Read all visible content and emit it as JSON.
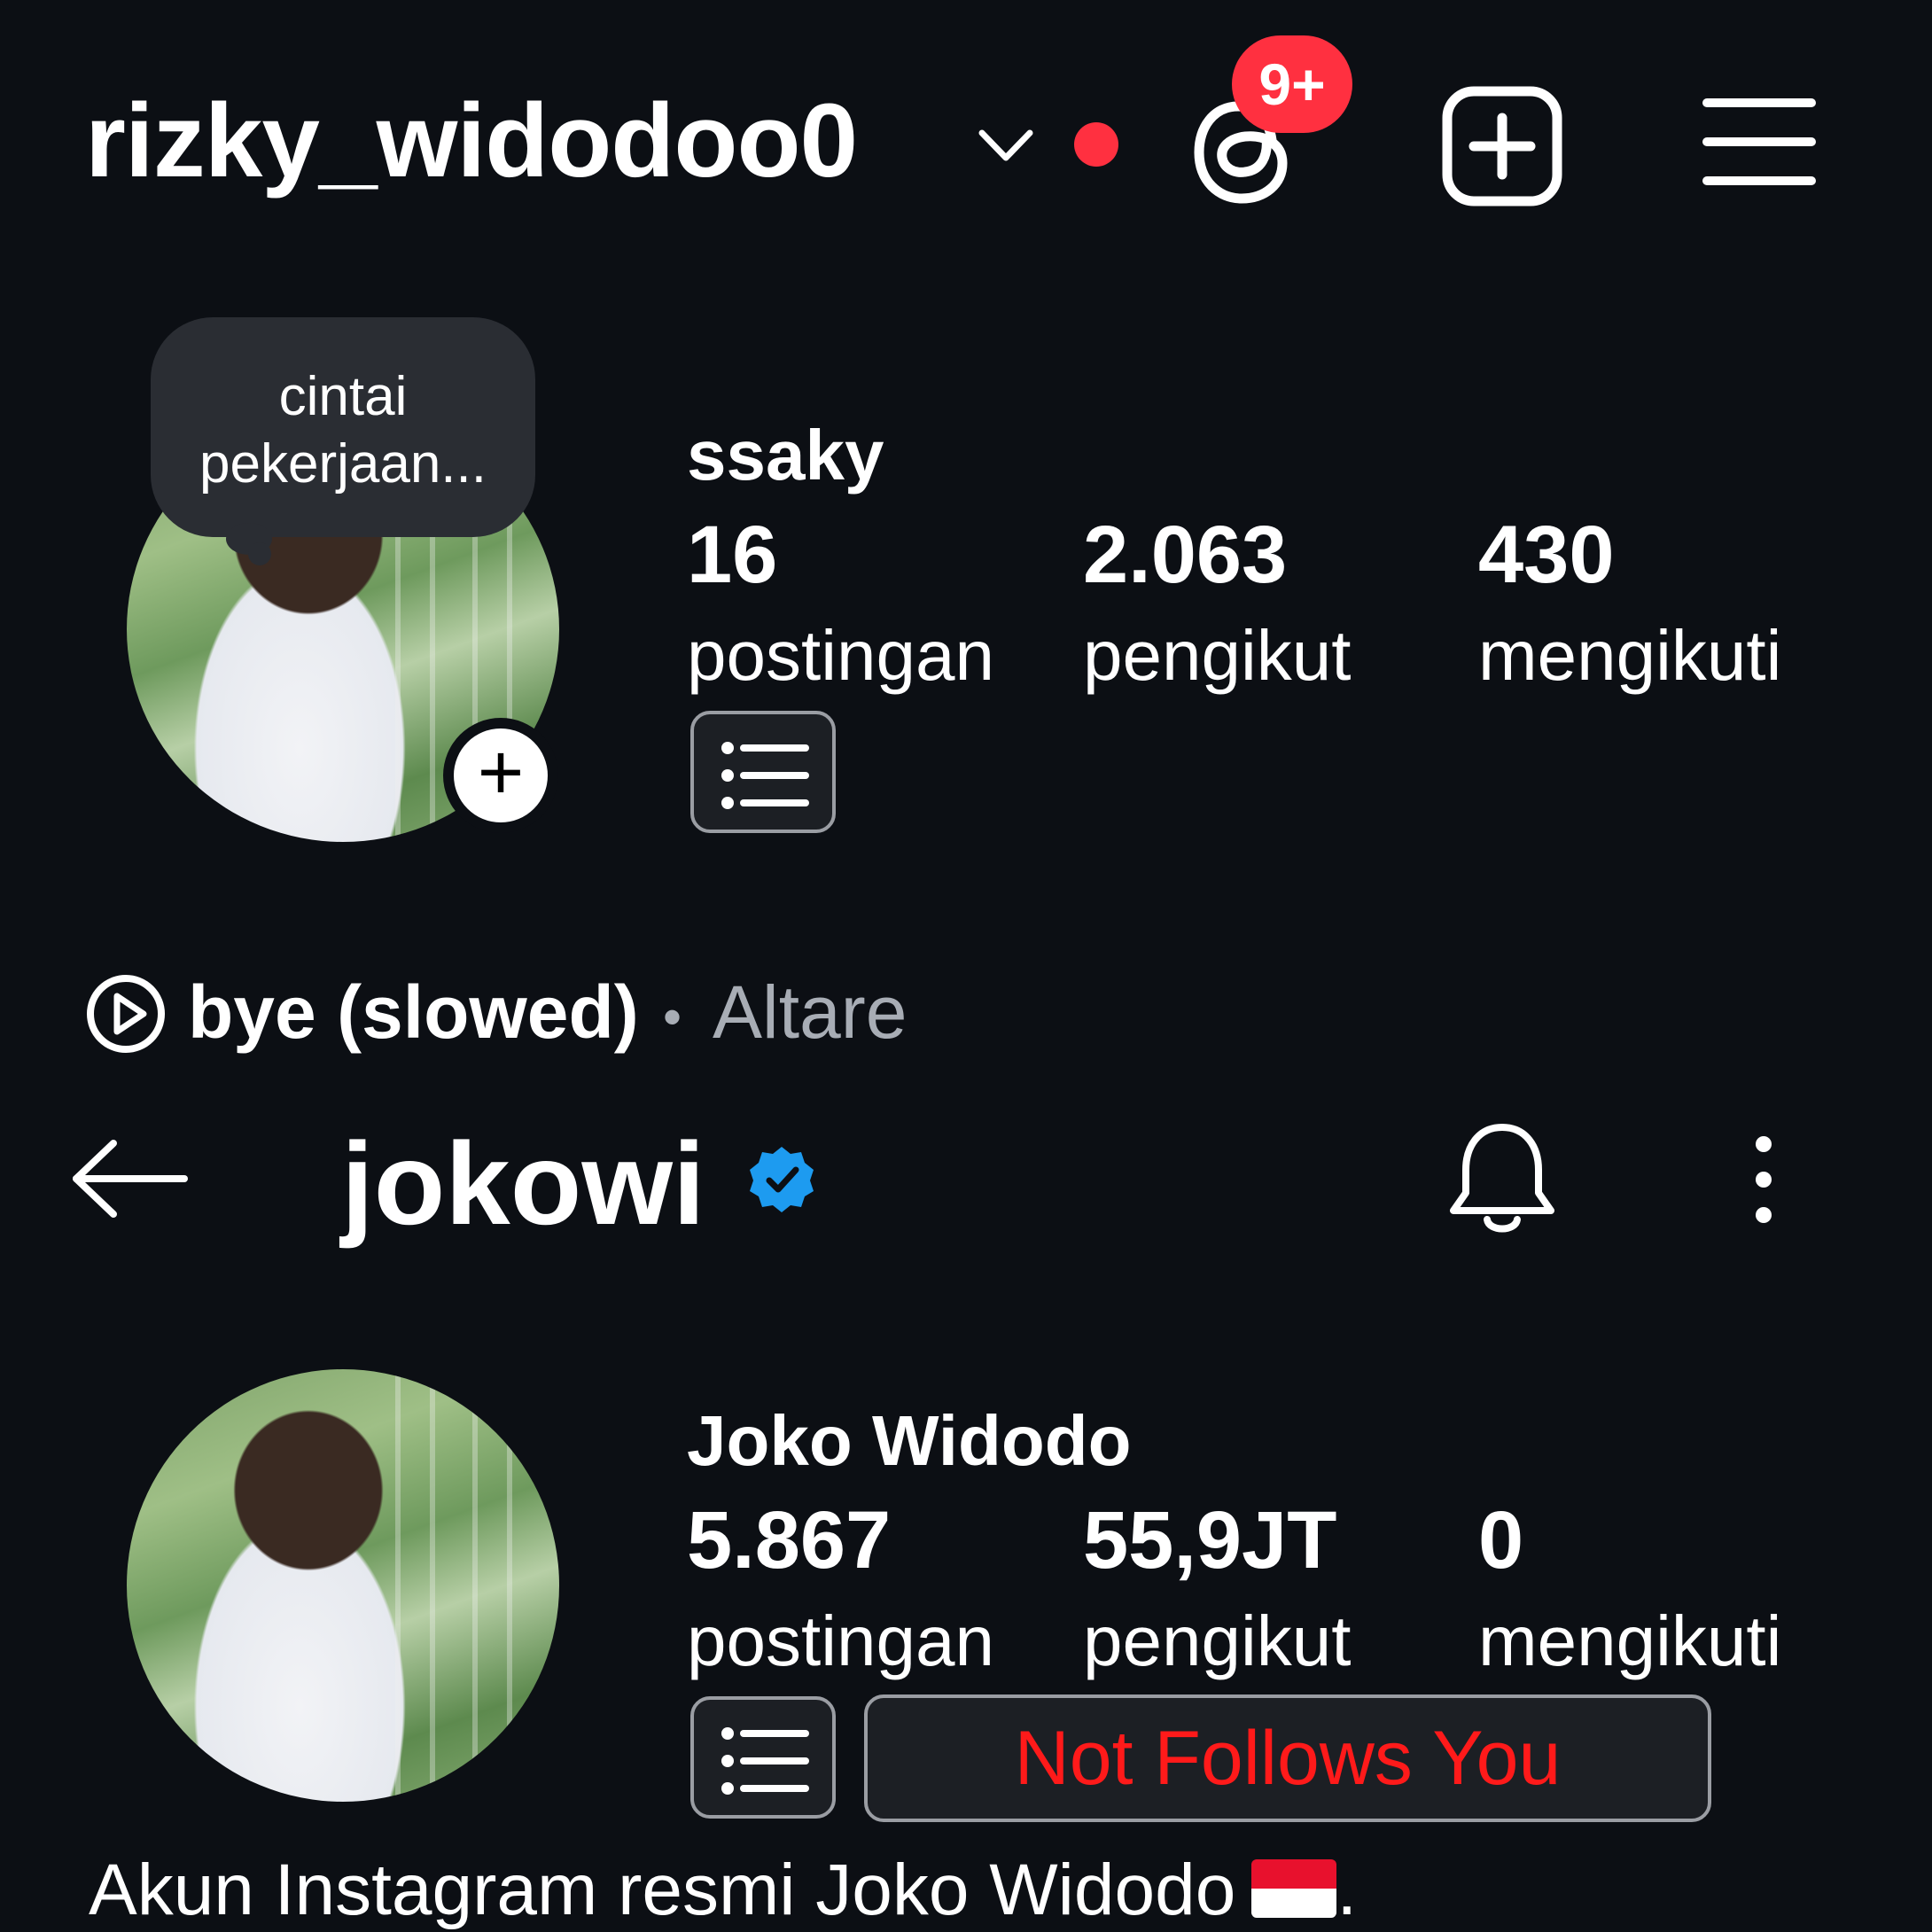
{
  "top_bar": {
    "account_username": "rizky_widodoo0",
    "threads_badge": "9+",
    "icons": [
      "chevron-down-icon",
      "notification-dot",
      "threads-icon",
      "new-post-icon",
      "menu-icon"
    ]
  },
  "own_profile": {
    "note_text": "cintai pekerjaan...",
    "display_name": "ssaky",
    "stats": [
      {
        "value": "16",
        "label": "postingan"
      },
      {
        "value": "2.063",
        "label": "pengikut"
      },
      {
        "value": "430",
        "label": "mengikuti"
      }
    ]
  },
  "music": {
    "song": "bye (slowed)",
    "separator": "•",
    "artist": "Altare"
  },
  "viewed_profile": {
    "handle": "jokowi",
    "verified": true,
    "display_name": "Joko Widodo",
    "stats": [
      {
        "value": "5.867",
        "label": "postingan"
      },
      {
        "value": "55,9JT",
        "label": "pengikut"
      },
      {
        "value": "0",
        "label": "mengikuti"
      }
    ],
    "follow_status": "Not Follows You",
    "bio": "Akun Instagram resmi Joko Widodo",
    "bio_suffix": "."
  },
  "colors": {
    "background": "#0c0f14",
    "badge_red": "#ff3040",
    "verified_blue": "#1d9bf0",
    "not_follows_red": "#ff1a1a",
    "muted_text": "#a8adb5"
  }
}
